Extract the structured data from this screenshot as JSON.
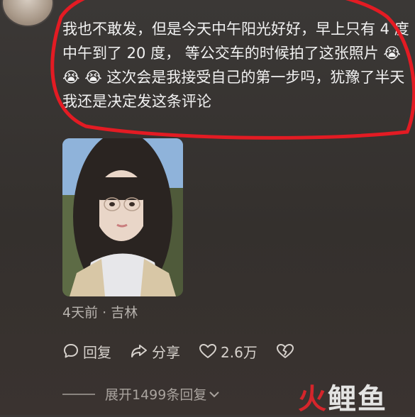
{
  "comment": {
    "text": "我也不敢发，但是今天中午阳光好好，早上只有 4 度中午到了 20 度， 等公交车的时候拍了这张照片 😭 😭 😭 这次会是我接受自己的第一步吗，犹豫了半天我还是决定发这条评论",
    "meta": "4天前 · 吉林"
  },
  "actions": {
    "reply_label": "回复",
    "share_label": "分享",
    "like_count": "2.6万"
  },
  "replies": {
    "expand_label": "展开1499条回复"
  },
  "watermark": {
    "part1": "火",
    "part2": "鲤鱼"
  },
  "colors": {
    "background": "#36322f",
    "text": "#f1f1f1",
    "muted_text": "#b8b3ae",
    "highlight_circle": "#e31b23"
  },
  "icons": [
    "avatar",
    "reply-icon",
    "share-icon",
    "heart-icon",
    "dislike-icon",
    "chevron-down-icon"
  ]
}
